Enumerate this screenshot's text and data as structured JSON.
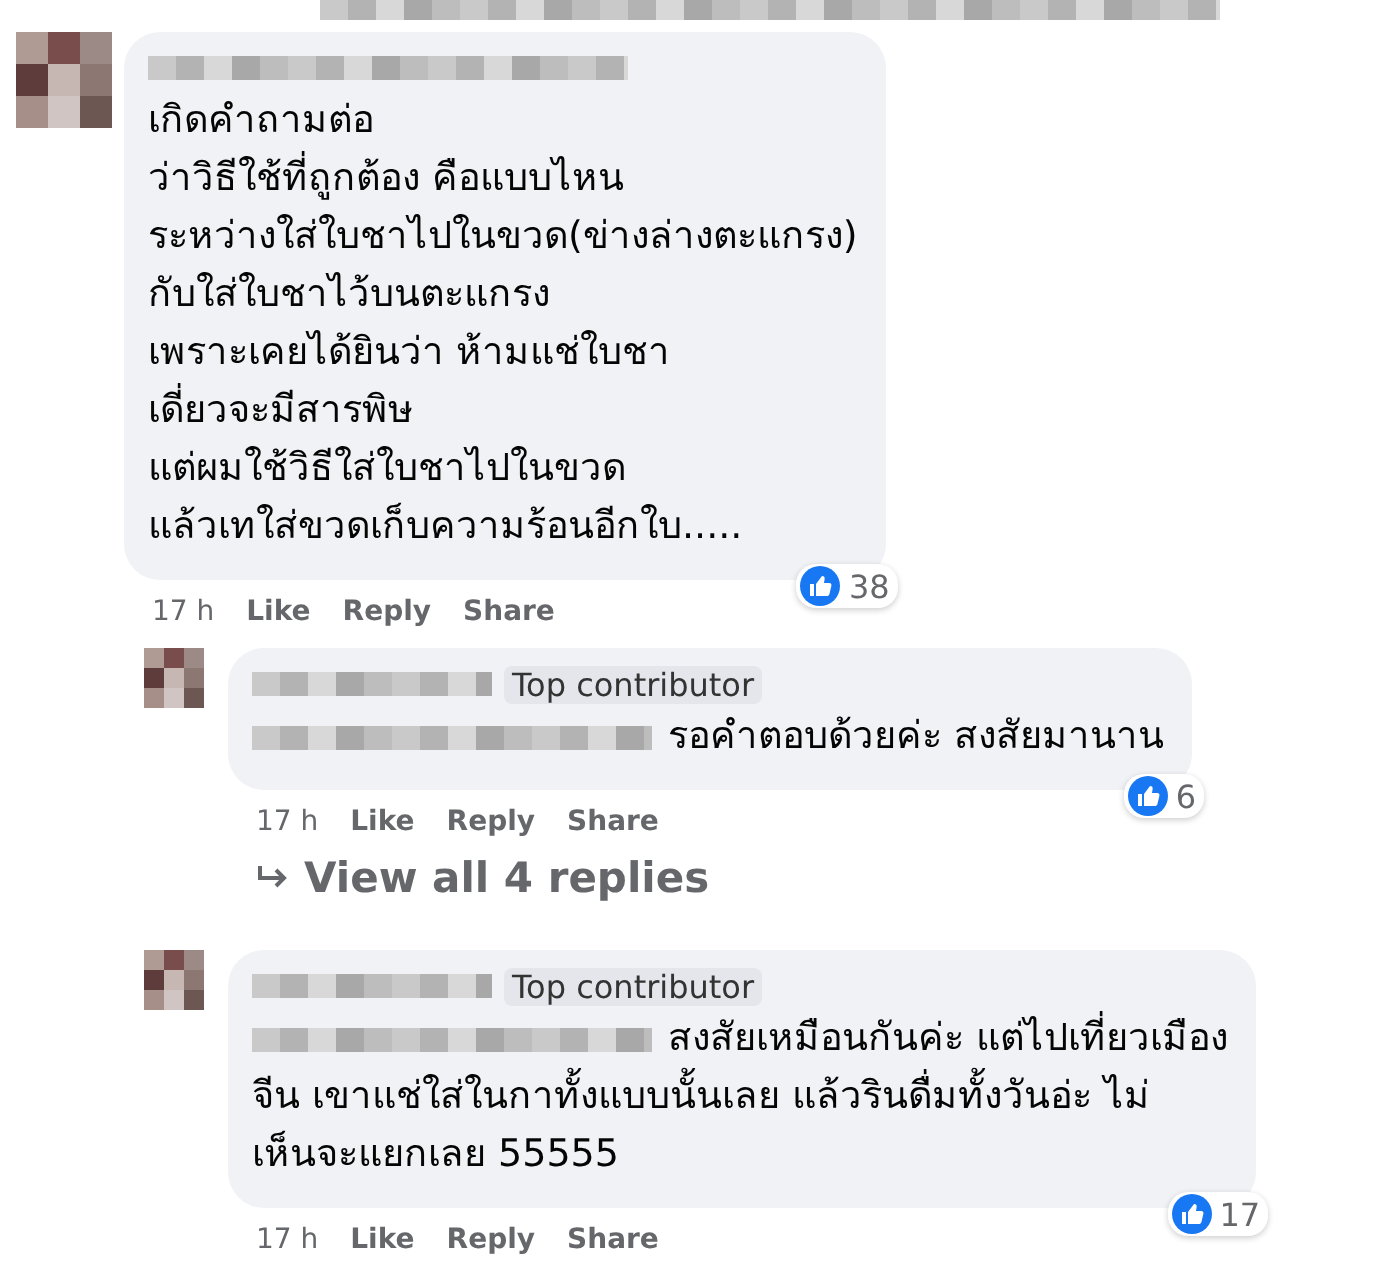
{
  "comment": {
    "lines": [
      "เกิดคำถามต่อ",
      "ว่าวิธีใช้ที่ถูกต้อง คือแบบไหน",
      "ระหว่างใส่ใบชาไปในขวด(ข่างล่างตะแกรง)",
      "กับใส่ใบชาไว้บนตะแกรง",
      "เพราะเคยได้ยินว่า ห้ามแช่ใบชา",
      "เดี่ยวจะมีสารพิษ",
      "แต่ผมใช้วิธีใส่ใบชาไปในขวด",
      "แล้วเทใส่ขวดเก็บความร้อนอีกใบ....."
    ],
    "time": "17 h",
    "actions": [
      "Like",
      "Reply",
      "Share"
    ],
    "reactions": "38"
  },
  "replies": [
    {
      "badge": "Top contributor",
      "mention_redacted": true,
      "lines": [
        "รอคำตอบด้วยค่ะ สงสัยมานาน"
      ],
      "time": "17 h",
      "actions": [
        "Like",
        "Reply",
        "Share"
      ],
      "reactions": "6",
      "view_replies": "View all 4 replies"
    },
    {
      "badge": "Top contributor",
      "mention_redacted": true,
      "lines": [
        "สงสัยเหมือนกันค่ะ แต่ไปเที่ยวเมือง",
        "จีน เขาแช่ใส่ในกาทั้งแบบนั้นเลย แล้วรินดื่มทั้งวันอ่ะ ไม่",
        "เห็นจะแยกเลย 55555"
      ],
      "time": "17 h",
      "actions": [
        "Like",
        "Reply",
        "Share"
      ],
      "reactions": "17"
    }
  ]
}
